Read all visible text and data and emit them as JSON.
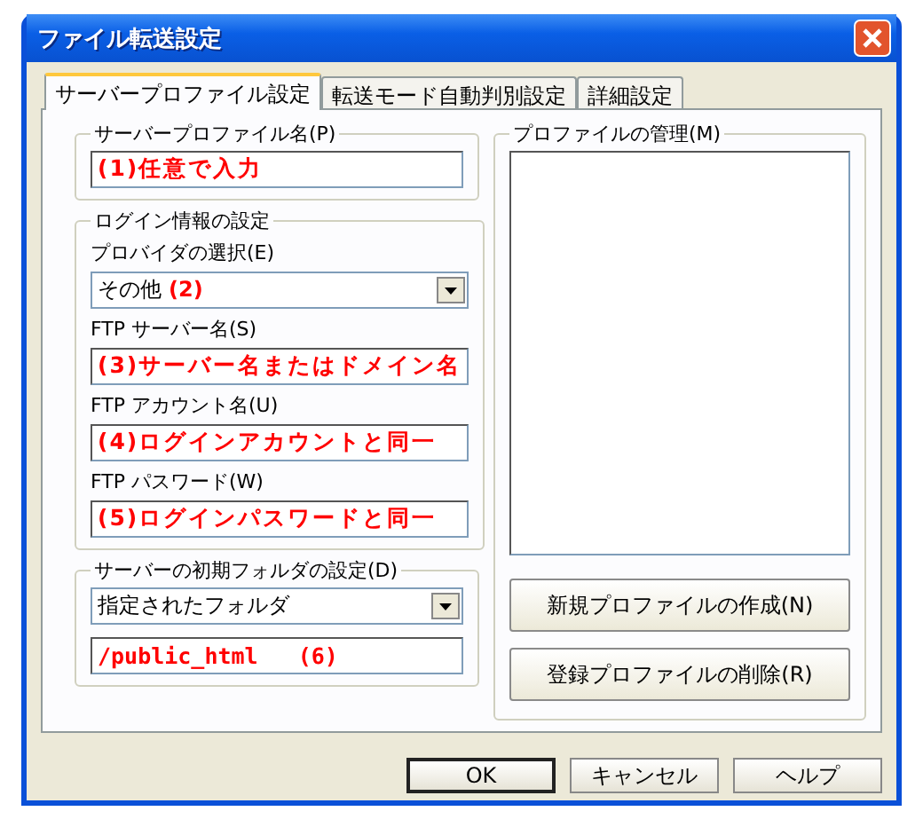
{
  "window": {
    "title": "ファイル転送設定"
  },
  "tabs": [
    {
      "label": "サーバープロファイル設定",
      "selected": true
    },
    {
      "label": "転送モード自動判別設定",
      "selected": false
    },
    {
      "label": "詳細設定",
      "selected": false
    }
  ],
  "server_profile_name": {
    "legend": "サーバープロファイル名(P)",
    "value": "(1)任意で入力"
  },
  "login": {
    "legend": "ログイン情報の設定",
    "fields": [
      {
        "kind": "select",
        "label": "プロバイダの選択(E)",
        "value": "その他",
        "annotation": "(2)"
      },
      {
        "kind": "text",
        "label": "FTP サーバー名(S)",
        "value": "(3)サーバー名またはドメイン名"
      },
      {
        "kind": "text",
        "label": "FTP アカウント名(U)",
        "value": "(4)ログインアカウントと同一"
      },
      {
        "kind": "text",
        "label": "FTP パスワード(W)",
        "value": "(5)ログインパスワードと同一"
      }
    ]
  },
  "initial_folder": {
    "legend": "サーバーの初期フォルダの設定(D)",
    "select": "指定されたフォルダ",
    "path": "/public_html   (6)"
  },
  "profile_management": {
    "legend": "プロファイルの管理(M)",
    "buttons": [
      "新規プロファイルの作成(N)",
      "登録プロファイルの削除(R)"
    ]
  },
  "buttons": [
    {
      "label": "OK",
      "default": true
    },
    {
      "label": "キャンセル",
      "default": false
    },
    {
      "label": "ヘルプ",
      "default": false
    }
  ]
}
